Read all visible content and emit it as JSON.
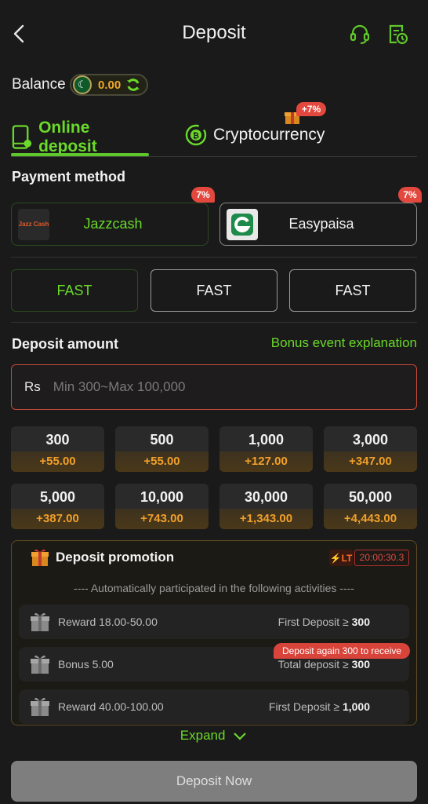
{
  "header": {
    "title": "Deposit",
    "back_icon": "back-arrow-icon",
    "support_icon": "headset-icon",
    "records_icon": "records-icon"
  },
  "balance": {
    "label": "Balance",
    "value": "0.00",
    "flag_icon": "pakistan-flag-icon",
    "refresh_icon": "refresh-icon"
  },
  "tabs": [
    {
      "label": "Online deposit",
      "active": true,
      "icon": "phone-icon"
    },
    {
      "label": "Cryptocurrency",
      "active": false,
      "icon": "bitcoin-icon",
      "badge": "+7%"
    }
  ],
  "payment": {
    "title": "Payment method",
    "methods": [
      {
        "name": "Jazzcash",
        "logo_text": "Jazz Cash",
        "badge": "7%",
        "selected": true
      },
      {
        "name": "Easypaisa",
        "badge": "7%",
        "selected": false
      }
    ]
  },
  "channels": [
    "FAST",
    "FAST",
    "FAST"
  ],
  "amount": {
    "title": "Deposit amount",
    "bonus_link": "Bonus event explanation",
    "currency": "Rs",
    "placeholder": "Min 300~Max 100,000",
    "options": [
      {
        "amount": "300",
        "bonus": "+55.00"
      },
      {
        "amount": "500",
        "bonus": "+55.00"
      },
      {
        "amount": "1,000",
        "bonus": "+127.00"
      },
      {
        "amount": "3,000",
        "bonus": "+347.00"
      },
      {
        "amount": "5,000",
        "bonus": "+387.00"
      },
      {
        "amount": "10,000",
        "bonus": "+743.00"
      },
      {
        "amount": "30,000",
        "bonus": "+1,343.00"
      },
      {
        "amount": "50,000",
        "bonus": "+4,443.00"
      }
    ]
  },
  "promotion": {
    "title": "Deposit promotion",
    "lt_label": "LT",
    "countdown": "20:00:30.3",
    "subtitle": "---- Automatically participated in the following activities ----",
    "rows": [
      {
        "left": "Reward 18.00-50.00",
        "right_label": "First Deposit ≥",
        "right_value": "300"
      },
      {
        "left": "Bonus 5.00",
        "right_label": "Total deposit ≥",
        "right_value": "300",
        "tag": "Deposit again 300 to receive"
      },
      {
        "left": "Reward 40.00-100.00",
        "right_label": "First Deposit ≥",
        "right_value": "1,000"
      }
    ],
    "expand": "Expand"
  },
  "cta": {
    "label": "Deposit Now"
  },
  "colors": {
    "accent": "#6ad92a",
    "bonus": "#f2a02a",
    "badge": "#e2483d"
  }
}
